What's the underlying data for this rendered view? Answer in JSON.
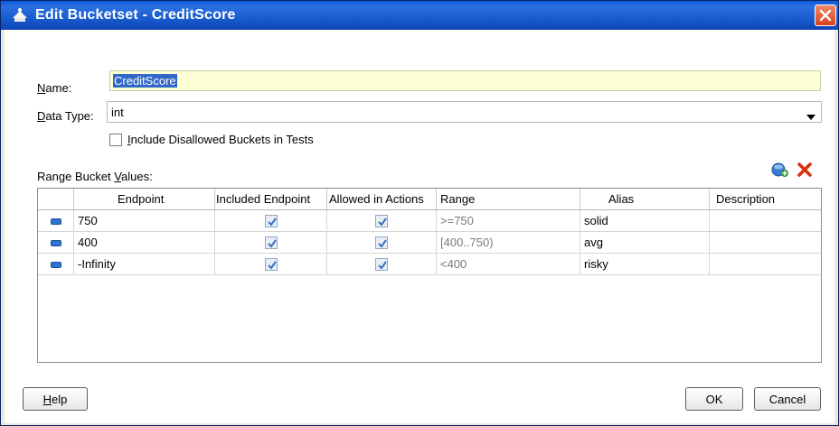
{
  "window": {
    "title": "Edit Bucketset - CreditScore"
  },
  "form": {
    "name_label": "Name:",
    "name_value": "CreditScore",
    "datatype_label": "Data Type:",
    "datatype_value": "int",
    "include_label": "Include Disallowed Buckets in Tests",
    "include_checked": false,
    "range_label": "Range Bucket Values:"
  },
  "table": {
    "columns": [
      "Endpoint",
      "Included Endpoint",
      "Allowed in Actions",
      "Range",
      "Alias",
      "Description"
    ],
    "rows": [
      {
        "endpoint": "750",
        "included": true,
        "allowed": true,
        "range": ">=750",
        "alias": "solid",
        "description": ""
      },
      {
        "endpoint": "400",
        "included": true,
        "allowed": true,
        "range": "[400..750)",
        "alias": "avg",
        "description": ""
      },
      {
        "endpoint": "-Infinity",
        "included": true,
        "allowed": true,
        "range": "<400",
        "alias": "risky",
        "description": ""
      }
    ]
  },
  "buttons": {
    "help": "Help",
    "ok": "OK",
    "cancel": "Cancel"
  },
  "icons": {
    "title": "app-icon",
    "add": "add-bucket-icon",
    "delete": "delete-bucket-icon",
    "close": "close-icon"
  },
  "colors": {
    "titlebar": "#0a5ad8",
    "name_input_bg": "#ffffd6",
    "selection": "#3168c8",
    "delete_red": "#d83010",
    "add_green": "#2f9a2f"
  }
}
